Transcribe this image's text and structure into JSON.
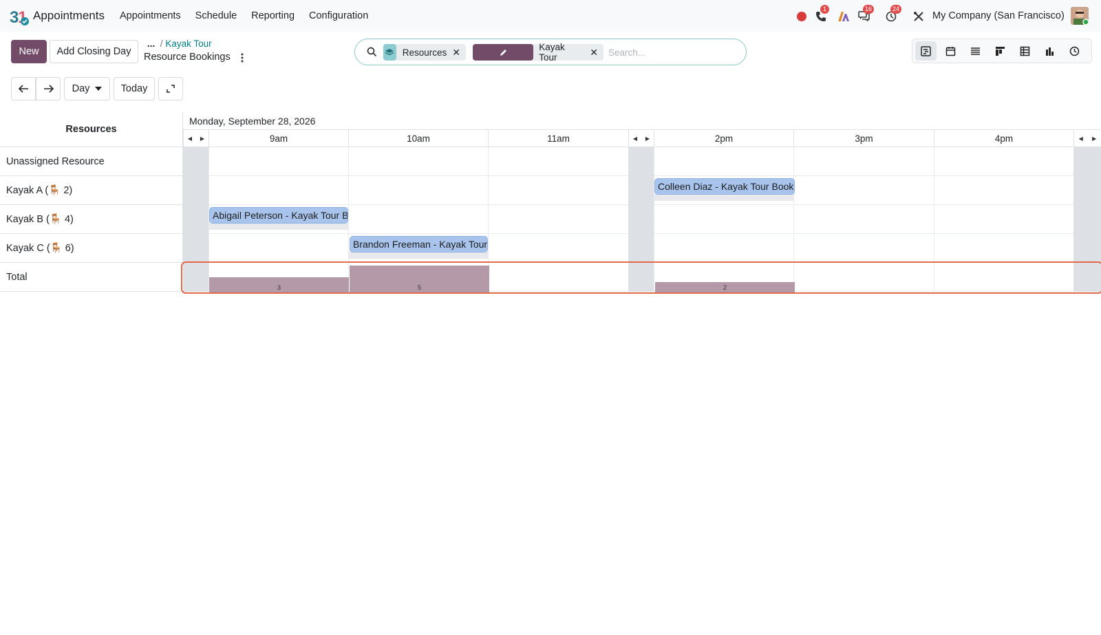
{
  "app": {
    "name": "Appointments",
    "menu": [
      "Appointments",
      "Schedule",
      "Reporting",
      "Configuration"
    ]
  },
  "systray": {
    "phone_badge": "1",
    "messages_badge": "16",
    "activities_badge": "24",
    "company": "My Company (San Francisco)"
  },
  "toolbar": {
    "new_label": "New",
    "closing_day_label": "Add Closing Day",
    "breadcrumb_ellipsis": "...",
    "breadcrumb_parent": "Kayak Tour",
    "breadcrumb_current": "Resource Bookings"
  },
  "search": {
    "facets": [
      {
        "label": "Resources"
      },
      {
        "label": "Kayak Tour"
      }
    ],
    "placeholder": "Search..."
  },
  "navigation": {
    "scale_label": "Day",
    "today_label": "Today"
  },
  "gantt": {
    "header_label": "Resources",
    "date_label": "Monday, September 28, 2026",
    "hours": [
      "9am",
      "10am",
      "11am",
      "2pm",
      "3pm",
      "4pm"
    ],
    "rows": [
      {
        "label": "Unassigned Resource"
      },
      {
        "label": "Kayak A (🪑 2)"
      },
      {
        "label": "Kayak B (🪑 4)"
      },
      {
        "label": "Kayak C (🪑 6)"
      }
    ],
    "total_label": "Total",
    "bookings": [
      {
        "label": "Colleen Diaz - Kayak Tour Booking",
        "row": 1,
        "hour": "2pm"
      },
      {
        "label": "Abigail Peterson - Kayak Tour Booking",
        "row": 2,
        "hour": "9am"
      },
      {
        "label": "Brandon Freeman - Kayak Tour Booking",
        "row": 3,
        "hour": "10am"
      }
    ],
    "totals": [
      {
        "hour": "9am",
        "value": "3"
      },
      {
        "hour": "10am",
        "value": "5"
      },
      {
        "hour": "2pm",
        "value": "2"
      }
    ]
  },
  "colors": {
    "brand": "#714b67",
    "pill": "#a8c4ec",
    "total_bar": "#b49aa9",
    "highlight": "#e06a4a"
  }
}
